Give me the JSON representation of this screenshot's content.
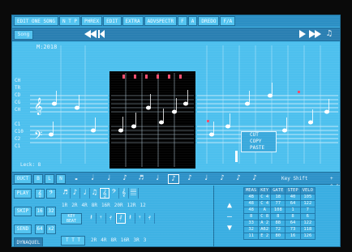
{
  "menu": {
    "items": [
      "EDIT ONE SONG",
      "N T P",
      "PHREX",
      "EDIT",
      "EXTRA",
      "ADVSPECTR",
      "F",
      "A",
      "DREDO",
      "F/A"
    ]
  },
  "transport": {
    "song_label": "Song",
    "buttons": [
      "rewind",
      "back",
      "play",
      "fast-forward"
    ],
    "note_icon": "♫"
  },
  "staff": {
    "title": "M:2018",
    "tracks": [
      "CH",
      "TR",
      "CD",
      "CG",
      "CH",
      "C1",
      "C10",
      "C2",
      "C1"
    ],
    "bar_label": "Leck: 8",
    "edit_menu": [
      "CUT",
      "COPY",
      "PASTE"
    ]
  },
  "palette": {
    "left_buttons": [
      "OUCT",
      "B",
      "L",
      "N"
    ],
    "notes": [
      "𝅝",
      "𝅗𝅥",
      "♩",
      "♪",
      "♬",
      "♩",
      "♪",
      "♪",
      "♩",
      "♪",
      "♪",
      "♪"
    ],
    "key_shift_label": "Key Shift",
    "key_shift_value": "+ 0.00"
  },
  "controls": {
    "left_buttons": [
      "PLAY",
      "SKIP",
      "SEND"
    ],
    "step_label_1": "16",
    "step_label_2": "32",
    "step_label_3": "64",
    "step_label_4": "x2",
    "row1_glyphs": [
      "♬",
      "♪",
      "♩",
      "♫",
      "𝄞",
      "𝄢",
      "𝄞",
      "𝄚"
    ],
    "row2_numbers": [
      "1R",
      "2R",
      "4R",
      "8R",
      "16R",
      "20R",
      "12R",
      "12"
    ],
    "row3_label": "KEY BEAT",
    "row3_glyphs": [
      "𝄽",
      "𝄾",
      "𝄿",
      "𝅀",
      "𝄽",
      "𝄾",
      "𝄿"
    ],
    "row4_numbers": [
      "2R",
      "4R",
      "8R",
      "16R",
      "3R",
      "3"
    ],
    "ttt_label": "T T T",
    "dynamics_label": "DYNAQUEL"
  },
  "event_list": {
    "headers": [
      "MEAS",
      "KEY",
      "GATE",
      "STEP",
      "VELO"
    ],
    "rows": [
      [
        "4B",
        "C 4",
        "18",
        "40",
        "105"
      ],
      [
        "48",
        "C 4",
        "77",
        "64",
        "122"
      ],
      [
        "48",
        "A",
        "108",
        "1",
        "7"
      ],
      [
        "8",
        "C 8",
        "8",
        "8",
        "6"
      ],
      [
        "33",
        "A 2",
        "88",
        "64",
        "122"
      ],
      [
        "32",
        "A62",
        "72",
        "73",
        "118"
      ],
      [
        "11",
        "E 2",
        "80",
        "16",
        "126"
      ]
    ],
    "arrows": [
      "▲",
      "—",
      "▼"
    ]
  },
  "colors": {
    "screen_bg": "#41b8ea",
    "staff_bg": "#4dc0ee",
    "piano_roll_bg": "#000000",
    "note_color": "#ffffff",
    "accent_red": "#ff4d6d"
  }
}
